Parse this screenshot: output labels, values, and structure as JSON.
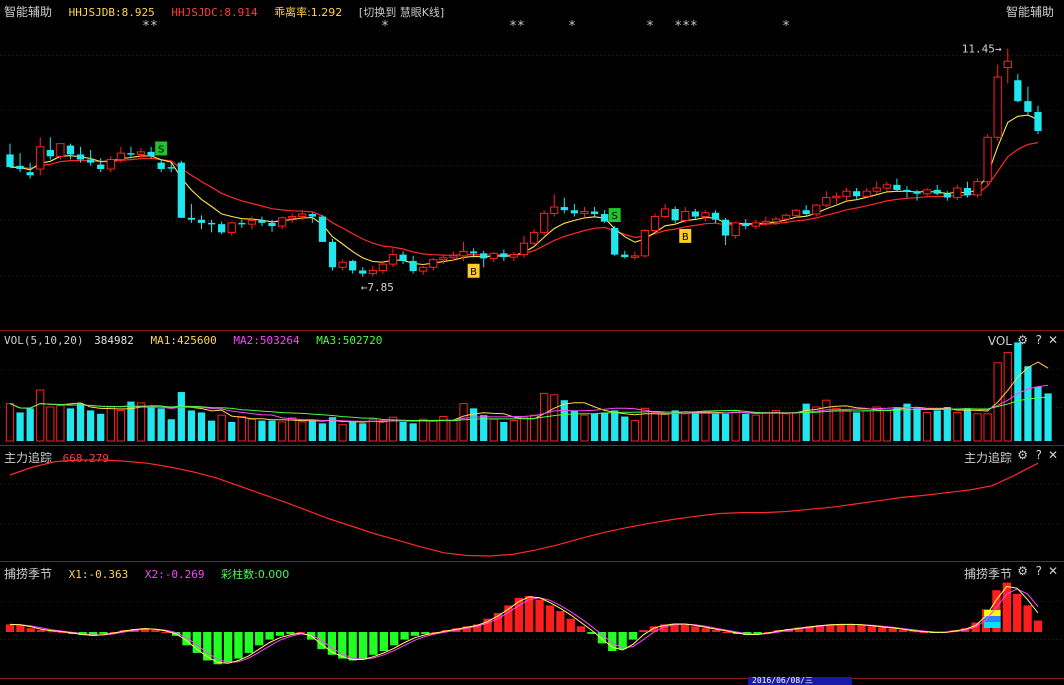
{
  "main": {
    "title": "智能辅助",
    "right_title": "智能辅助",
    "indicators": [
      {
        "label": "HHJSJDB:8.925",
        "color": "#ffd54a"
      },
      {
        "label": "HHJSJDC:8.914",
        "color": "#ff3b3b"
      },
      {
        "label": "乖离率:1.292",
        "color": "#ffd54a"
      },
      {
        "label": "[切换到 慧眼K线]",
        "color": "#c8c8c8"
      }
    ],
    "high_label": "11.45→",
    "low_label": "←7.85",
    "star_marks": [
      "**",
      "*",
      "**",
      "*",
      "*",
      "***",
      "*"
    ],
    "signal_letters": {
      "sell": "S",
      "buy": "B"
    }
  },
  "vol_pane": {
    "title": "VOL(5,10,20)",
    "value": "384982",
    "ma1": "MA1:425600",
    "ma2": "MA2:503264",
    "ma3": "MA3:502720",
    "right_title": "VOL",
    "colors": {
      "ma1": "#ffd54a",
      "ma2": "#ff44ff",
      "ma3": "#44ff44"
    }
  },
  "track_pane": {
    "title": "主力追踪",
    "value": "668.279",
    "right_title": "主力追踪"
  },
  "season_pane": {
    "title": "捕捞季节",
    "x1": "X1:-0.363",
    "x2": "X2:-0.269",
    "bars": "彩柱数:0.000",
    "right_title": "捕捞季节"
  },
  "controls": {
    "gear": "⚙",
    "help": "?",
    "close": "✕"
  },
  "axis_date": "2016/06/08/三",
  "colors": {
    "up": "#ff2020",
    "down": "#22e6ee",
    "ma_yellow": "#ffe44a",
    "ma_red": "#ff2828",
    "grid": "#5a0d0d",
    "bg": "#000000"
  },
  "chart_data": {
    "type": "candlestick",
    "price_range": [
      7.2,
      11.9
    ],
    "annotations": {
      "high": 11.45,
      "low": 7.85
    },
    "candles": [
      [
        9.78,
        9.95,
        9.58,
        9.58
      ],
      [
        9.6,
        9.8,
        9.5,
        9.55
      ],
      [
        9.5,
        9.65,
        9.4,
        9.45
      ],
      [
        9.55,
        10.05,
        9.45,
        9.9
      ],
      [
        9.85,
        10.05,
        9.7,
        9.75
      ],
      [
        9.75,
        9.95,
        9.7,
        9.95
      ],
      [
        9.92,
        9.95,
        9.7,
        9.78
      ],
      [
        9.78,
        9.9,
        9.65,
        9.7
      ],
      [
        9.7,
        9.85,
        9.6,
        9.65
      ],
      [
        9.62,
        9.72,
        9.5,
        9.55
      ],
      [
        9.55,
        9.75,
        9.5,
        9.7
      ],
      [
        9.7,
        9.9,
        9.65,
        9.8
      ],
      [
        9.8,
        9.9,
        9.72,
        9.78
      ],
      [
        9.78,
        9.88,
        9.7,
        9.82
      ],
      [
        9.82,
        9.9,
        9.72,
        9.75
      ],
      [
        9.65,
        9.7,
        9.5,
        9.55
      ],
      [
        9.58,
        9.65,
        9.5,
        9.56
      ],
      [
        9.65,
        9.68,
        8.78,
        8.78
      ],
      [
        8.78,
        9.0,
        8.7,
        8.75
      ],
      [
        8.75,
        8.82,
        8.6,
        8.7
      ],
      [
        8.7,
        8.75,
        8.55,
        8.68
      ],
      [
        8.68,
        8.72,
        8.52,
        8.55
      ],
      [
        8.55,
        8.72,
        8.5,
        8.7
      ],
      [
        8.7,
        8.75,
        8.62,
        8.68
      ],
      [
        8.68,
        8.8,
        8.6,
        8.74
      ],
      [
        8.74,
        8.8,
        8.65,
        8.7
      ],
      [
        8.7,
        8.75,
        8.56,
        8.65
      ],
      [
        8.65,
        8.8,
        8.6,
        8.78
      ],
      [
        8.78,
        8.85,
        8.7,
        8.8
      ],
      [
        8.8,
        8.9,
        8.74,
        8.84
      ],
      [
        8.84,
        8.86,
        8.7,
        8.8
      ],
      [
        8.8,
        8.82,
        8.4,
        8.4
      ],
      [
        8.4,
        8.45,
        7.95,
        8.0
      ],
      [
        8.0,
        8.12,
        7.95,
        8.08
      ],
      [
        8.1,
        8.12,
        7.9,
        7.95
      ],
      [
        7.95,
        8.0,
        7.85,
        7.9
      ],
      [
        7.9,
        8.02,
        7.85,
        7.95
      ],
      [
        7.95,
        8.1,
        7.9,
        8.05
      ],
      [
        8.05,
        8.3,
        8.0,
        8.2
      ],
      [
        8.2,
        8.25,
        8.05,
        8.1
      ],
      [
        8.1,
        8.18,
        7.9,
        7.94
      ],
      [
        7.94,
        8.02,
        7.88,
        8.0
      ],
      [
        8.0,
        8.15,
        7.95,
        8.12
      ],
      [
        8.12,
        8.2,
        8.05,
        8.15
      ],
      [
        8.15,
        8.25,
        8.1,
        8.18
      ],
      [
        8.18,
        8.4,
        8.1,
        8.25
      ],
      [
        8.25,
        8.3,
        8.15,
        8.22
      ],
      [
        8.22,
        8.26,
        8.0,
        8.14
      ],
      [
        8.14,
        8.24,
        8.08,
        8.22
      ],
      [
        8.22,
        8.28,
        8.1,
        8.16
      ],
      [
        8.16,
        8.24,
        8.1,
        8.2
      ],
      [
        8.2,
        8.5,
        8.15,
        8.38
      ],
      [
        8.38,
        8.6,
        8.35,
        8.55
      ],
      [
        8.55,
        8.9,
        8.5,
        8.85
      ],
      [
        8.85,
        9.15,
        8.8,
        8.95
      ],
      [
        8.95,
        9.1,
        8.85,
        8.9
      ],
      [
        8.9,
        9.0,
        8.8,
        8.85
      ],
      [
        8.85,
        8.95,
        8.78,
        8.88
      ],
      [
        8.88,
        8.95,
        8.8,
        8.84
      ],
      [
        8.84,
        8.9,
        8.7,
        8.72
      ],
      [
        8.62,
        8.65,
        8.18,
        8.2
      ],
      [
        8.2,
        8.26,
        8.14,
        8.16
      ],
      [
        8.16,
        8.25,
        8.12,
        8.18
      ],
      [
        8.18,
        8.6,
        8.15,
        8.58
      ],
      [
        8.58,
        8.85,
        8.55,
        8.8
      ],
      [
        8.8,
        9.0,
        8.78,
        8.92
      ],
      [
        8.92,
        8.96,
        8.7,
        8.74
      ],
      [
        8.74,
        8.95,
        8.7,
        8.88
      ],
      [
        8.88,
        8.92,
        8.76,
        8.8
      ],
      [
        8.8,
        8.9,
        8.72,
        8.86
      ],
      [
        8.86,
        8.9,
        8.7,
        8.75
      ],
      [
        8.75,
        8.78,
        8.35,
        8.5
      ],
      [
        8.5,
        8.72,
        8.45,
        8.7
      ],
      [
        8.7,
        8.76,
        8.6,
        8.65
      ],
      [
        8.65,
        8.75,
        8.6,
        8.7
      ],
      [
        8.7,
        8.8,
        8.65,
        8.72
      ],
      [
        8.72,
        8.8,
        8.66,
        8.76
      ],
      [
        8.76,
        8.85,
        8.7,
        8.82
      ],
      [
        8.82,
        8.92,
        8.78,
        8.9
      ],
      [
        8.9,
        8.98,
        8.8,
        8.84
      ],
      [
        8.84,
        9.0,
        8.8,
        8.98
      ],
      [
        8.98,
        9.2,
        8.95,
        9.1
      ],
      [
        9.1,
        9.18,
        9.0,
        9.12
      ],
      [
        9.12,
        9.25,
        9.05,
        9.2
      ],
      [
        9.2,
        9.25,
        9.08,
        9.12
      ],
      [
        9.12,
        9.25,
        9.1,
        9.2
      ],
      [
        9.2,
        9.35,
        9.15,
        9.25
      ],
      [
        9.25,
        9.35,
        9.2,
        9.3
      ],
      [
        9.3,
        9.4,
        9.2,
        9.22
      ],
      [
        9.22,
        9.28,
        9.1,
        9.2
      ],
      [
        9.2,
        9.22,
        9.05,
        9.16
      ],
      [
        9.16,
        9.25,
        9.1,
        9.22
      ],
      [
        9.22,
        9.3,
        9.14,
        9.16
      ],
      [
        9.16,
        9.2,
        9.05,
        9.1
      ],
      [
        9.1,
        9.3,
        9.06,
        9.25
      ],
      [
        9.25,
        9.35,
        9.1,
        9.14
      ],
      [
        9.14,
        9.4,
        9.1,
        9.35
      ],
      [
        9.35,
        10.1,
        9.3,
        10.05
      ],
      [
        10.05,
        11.2,
        10.0,
        11.0
      ],
      [
        11.15,
        11.45,
        10.9,
        11.25
      ],
      [
        10.95,
        11.05,
        10.6,
        10.62
      ],
      [
        10.62,
        10.85,
        10.4,
        10.45
      ],
      [
        10.45,
        10.55,
        10.1,
        10.15
      ]
    ],
    "vol_values": [
      0.55,
      0.42,
      0.48,
      0.75,
      0.5,
      0.52,
      0.48,
      0.55,
      0.45,
      0.4,
      0.5,
      0.45,
      0.58,
      0.56,
      0.5,
      0.48,
      0.32,
      0.72,
      0.45,
      0.42,
      0.3,
      0.38,
      0.28,
      0.36,
      0.32,
      0.3,
      0.3,
      0.28,
      0.34,
      0.28,
      0.3,
      0.26,
      0.35,
      0.24,
      0.28,
      0.26,
      0.32,
      0.3,
      0.35,
      0.28,
      0.26,
      0.32,
      0.3,
      0.36,
      0.3,
      0.55,
      0.48,
      0.38,
      0.32,
      0.28,
      0.3,
      0.35,
      0.38,
      0.7,
      0.68,
      0.6,
      0.45,
      0.38,
      0.4,
      0.42,
      0.45,
      0.36,
      0.3,
      0.48,
      0.42,
      0.4,
      0.45,
      0.4,
      0.42,
      0.44,
      0.4,
      0.4,
      0.45,
      0.4,
      0.38,
      0.42,
      0.45,
      0.4,
      0.42,
      0.55,
      0.5,
      0.6,
      0.48,
      0.45,
      0.42,
      0.44,
      0.5,
      0.45,
      0.5,
      0.55,
      0.48,
      0.42,
      0.45,
      0.5,
      0.42,
      0.48,
      0.4,
      0.4,
      1.15,
      1.3,
      1.45,
      1.1,
      0.8,
      0.7
    ],
    "vol_up": [
      true,
      false,
      false,
      true,
      true,
      true,
      false,
      false,
      false,
      false,
      true,
      true,
      false,
      true,
      false,
      false,
      false,
      false,
      false,
      false,
      false,
      true,
      false,
      true,
      true,
      false,
      false,
      true,
      true,
      true,
      false,
      false,
      false,
      true,
      false,
      false,
      true,
      true,
      true,
      false,
      false,
      true,
      true,
      true,
      true,
      true,
      false,
      false,
      true,
      false,
      true,
      true,
      true,
      true,
      true,
      false,
      false,
      true,
      false,
      false,
      false,
      false,
      true,
      true,
      true,
      true,
      false,
      true,
      false,
      true,
      false,
      false,
      true,
      false,
      true,
      true,
      true,
      true,
      true,
      false,
      true,
      true,
      true,
      true,
      false,
      true,
      true,
      true,
      false,
      false,
      false,
      true,
      false,
      false,
      true,
      false,
      true,
      true,
      true,
      true,
      false,
      false,
      false,
      false
    ],
    "track_values": [
      9.4,
      9.55,
      9.65,
      9.68,
      9.68,
      9.66,
      9.62,
      9.55,
      9.46,
      9.35,
      9.2,
      9.05,
      8.9,
      8.74,
      8.58,
      8.44,
      8.3,
      8.18,
      8.06,
      7.95,
      7.9,
      7.89,
      7.92,
      8.0,
      8.1,
      8.22,
      8.33,
      8.42,
      8.5,
      8.57,
      8.63,
      8.68,
      8.7,
      8.7,
      8.72,
      8.76,
      8.8,
      8.86,
      8.92,
      8.98,
      9.02,
      9.07,
      9.12,
      9.2,
      9.4,
      9.62
    ],
    "season_values": [
      0.2,
      0.18,
      0.1,
      0.05,
      0.02,
      0.0,
      -0.05,
      -0.08,
      -0.1,
      -0.05,
      0.0,
      0.05,
      0.08,
      0.1,
      0.05,
      0.0,
      -0.1,
      -0.35,
      -0.55,
      -0.75,
      -0.85,
      -0.8,
      -0.7,
      -0.55,
      -0.35,
      -0.2,
      -0.1,
      -0.05,
      0.0,
      -0.2,
      -0.45,
      -0.6,
      -0.7,
      -0.75,
      -0.7,
      -0.6,
      -0.5,
      -0.35,
      -0.2,
      -0.1,
      -0.05,
      0.0,
      0.05,
      0.1,
      0.15,
      0.2,
      0.35,
      0.5,
      0.7,
      0.9,
      0.95,
      0.85,
      0.7,
      0.55,
      0.35,
      0.15,
      -0.05,
      -0.3,
      -0.5,
      -0.45,
      -0.2,
      0.05,
      0.15,
      0.2,
      0.22,
      0.2,
      0.15,
      0.1,
      0.05,
      0.0,
      -0.05,
      -0.08,
      -0.05,
      0.0,
      0.05,
      0.08,
      0.12,
      0.15,
      0.18,
      0.2,
      0.2,
      0.2,
      0.18,
      0.15,
      0.12,
      0.1,
      0.05,
      0.02,
      0.0,
      -0.02,
      0.0,
      0.05,
      0.1,
      0.25,
      0.6,
      1.1,
      1.3,
      1.0,
      0.7,
      0.3
    ]
  }
}
